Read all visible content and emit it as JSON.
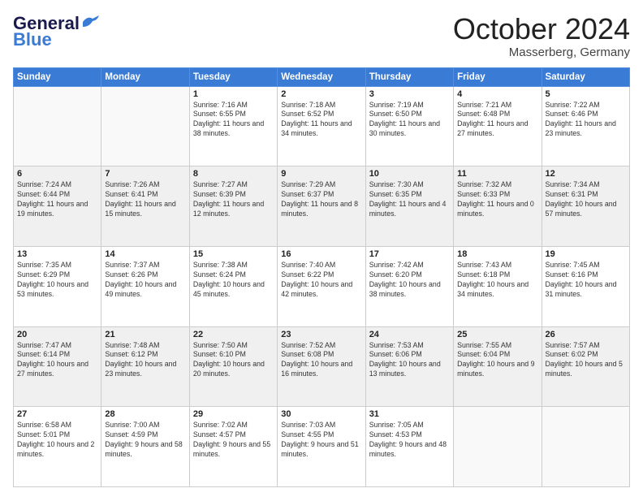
{
  "header": {
    "logo_line1": "General",
    "logo_line2": "Blue",
    "month": "October 2024",
    "location": "Masserberg, Germany"
  },
  "days_of_week": [
    "Sunday",
    "Monday",
    "Tuesday",
    "Wednesday",
    "Thursday",
    "Friday",
    "Saturday"
  ],
  "weeks": [
    [
      {
        "day": "",
        "sunrise": "",
        "sunset": "",
        "daylight": ""
      },
      {
        "day": "",
        "sunrise": "",
        "sunset": "",
        "daylight": ""
      },
      {
        "day": "1",
        "sunrise": "Sunrise: 7:16 AM",
        "sunset": "Sunset: 6:55 PM",
        "daylight": "Daylight: 11 hours and 38 minutes."
      },
      {
        "day": "2",
        "sunrise": "Sunrise: 7:18 AM",
        "sunset": "Sunset: 6:52 PM",
        "daylight": "Daylight: 11 hours and 34 minutes."
      },
      {
        "day": "3",
        "sunrise": "Sunrise: 7:19 AM",
        "sunset": "Sunset: 6:50 PM",
        "daylight": "Daylight: 11 hours and 30 minutes."
      },
      {
        "day": "4",
        "sunrise": "Sunrise: 7:21 AM",
        "sunset": "Sunset: 6:48 PM",
        "daylight": "Daylight: 11 hours and 27 minutes."
      },
      {
        "day": "5",
        "sunrise": "Sunrise: 7:22 AM",
        "sunset": "Sunset: 6:46 PM",
        "daylight": "Daylight: 11 hours and 23 minutes."
      }
    ],
    [
      {
        "day": "6",
        "sunrise": "Sunrise: 7:24 AM",
        "sunset": "Sunset: 6:44 PM",
        "daylight": "Daylight: 11 hours and 19 minutes."
      },
      {
        "day": "7",
        "sunrise": "Sunrise: 7:26 AM",
        "sunset": "Sunset: 6:41 PM",
        "daylight": "Daylight: 11 hours and 15 minutes."
      },
      {
        "day": "8",
        "sunrise": "Sunrise: 7:27 AM",
        "sunset": "Sunset: 6:39 PM",
        "daylight": "Daylight: 11 hours and 12 minutes."
      },
      {
        "day": "9",
        "sunrise": "Sunrise: 7:29 AM",
        "sunset": "Sunset: 6:37 PM",
        "daylight": "Daylight: 11 hours and 8 minutes."
      },
      {
        "day": "10",
        "sunrise": "Sunrise: 7:30 AM",
        "sunset": "Sunset: 6:35 PM",
        "daylight": "Daylight: 11 hours and 4 minutes."
      },
      {
        "day": "11",
        "sunrise": "Sunrise: 7:32 AM",
        "sunset": "Sunset: 6:33 PM",
        "daylight": "Daylight: 11 hours and 0 minutes."
      },
      {
        "day": "12",
        "sunrise": "Sunrise: 7:34 AM",
        "sunset": "Sunset: 6:31 PM",
        "daylight": "Daylight: 10 hours and 57 minutes."
      }
    ],
    [
      {
        "day": "13",
        "sunrise": "Sunrise: 7:35 AM",
        "sunset": "Sunset: 6:29 PM",
        "daylight": "Daylight: 10 hours and 53 minutes."
      },
      {
        "day": "14",
        "sunrise": "Sunrise: 7:37 AM",
        "sunset": "Sunset: 6:26 PM",
        "daylight": "Daylight: 10 hours and 49 minutes."
      },
      {
        "day": "15",
        "sunrise": "Sunrise: 7:38 AM",
        "sunset": "Sunset: 6:24 PM",
        "daylight": "Daylight: 10 hours and 45 minutes."
      },
      {
        "day": "16",
        "sunrise": "Sunrise: 7:40 AM",
        "sunset": "Sunset: 6:22 PM",
        "daylight": "Daylight: 10 hours and 42 minutes."
      },
      {
        "day": "17",
        "sunrise": "Sunrise: 7:42 AM",
        "sunset": "Sunset: 6:20 PM",
        "daylight": "Daylight: 10 hours and 38 minutes."
      },
      {
        "day": "18",
        "sunrise": "Sunrise: 7:43 AM",
        "sunset": "Sunset: 6:18 PM",
        "daylight": "Daylight: 10 hours and 34 minutes."
      },
      {
        "day": "19",
        "sunrise": "Sunrise: 7:45 AM",
        "sunset": "Sunset: 6:16 PM",
        "daylight": "Daylight: 10 hours and 31 minutes."
      }
    ],
    [
      {
        "day": "20",
        "sunrise": "Sunrise: 7:47 AM",
        "sunset": "Sunset: 6:14 PM",
        "daylight": "Daylight: 10 hours and 27 minutes."
      },
      {
        "day": "21",
        "sunrise": "Sunrise: 7:48 AM",
        "sunset": "Sunset: 6:12 PM",
        "daylight": "Daylight: 10 hours and 23 minutes."
      },
      {
        "day": "22",
        "sunrise": "Sunrise: 7:50 AM",
        "sunset": "Sunset: 6:10 PM",
        "daylight": "Daylight: 10 hours and 20 minutes."
      },
      {
        "day": "23",
        "sunrise": "Sunrise: 7:52 AM",
        "sunset": "Sunset: 6:08 PM",
        "daylight": "Daylight: 10 hours and 16 minutes."
      },
      {
        "day": "24",
        "sunrise": "Sunrise: 7:53 AM",
        "sunset": "Sunset: 6:06 PM",
        "daylight": "Daylight: 10 hours and 13 minutes."
      },
      {
        "day": "25",
        "sunrise": "Sunrise: 7:55 AM",
        "sunset": "Sunset: 6:04 PM",
        "daylight": "Daylight: 10 hours and 9 minutes."
      },
      {
        "day": "26",
        "sunrise": "Sunrise: 7:57 AM",
        "sunset": "Sunset: 6:02 PM",
        "daylight": "Daylight: 10 hours and 5 minutes."
      }
    ],
    [
      {
        "day": "27",
        "sunrise": "Sunrise: 6:58 AM",
        "sunset": "Sunset: 5:01 PM",
        "daylight": "Daylight: 10 hours and 2 minutes."
      },
      {
        "day": "28",
        "sunrise": "Sunrise: 7:00 AM",
        "sunset": "Sunset: 4:59 PM",
        "daylight": "Daylight: 9 hours and 58 minutes."
      },
      {
        "day": "29",
        "sunrise": "Sunrise: 7:02 AM",
        "sunset": "Sunset: 4:57 PM",
        "daylight": "Daylight: 9 hours and 55 minutes."
      },
      {
        "day": "30",
        "sunrise": "Sunrise: 7:03 AM",
        "sunset": "Sunset: 4:55 PM",
        "daylight": "Daylight: 9 hours and 51 minutes."
      },
      {
        "day": "31",
        "sunrise": "Sunrise: 7:05 AM",
        "sunset": "Sunset: 4:53 PM",
        "daylight": "Daylight: 9 hours and 48 minutes."
      },
      {
        "day": "",
        "sunrise": "",
        "sunset": "",
        "daylight": ""
      },
      {
        "day": "",
        "sunrise": "",
        "sunset": "",
        "daylight": ""
      }
    ]
  ]
}
